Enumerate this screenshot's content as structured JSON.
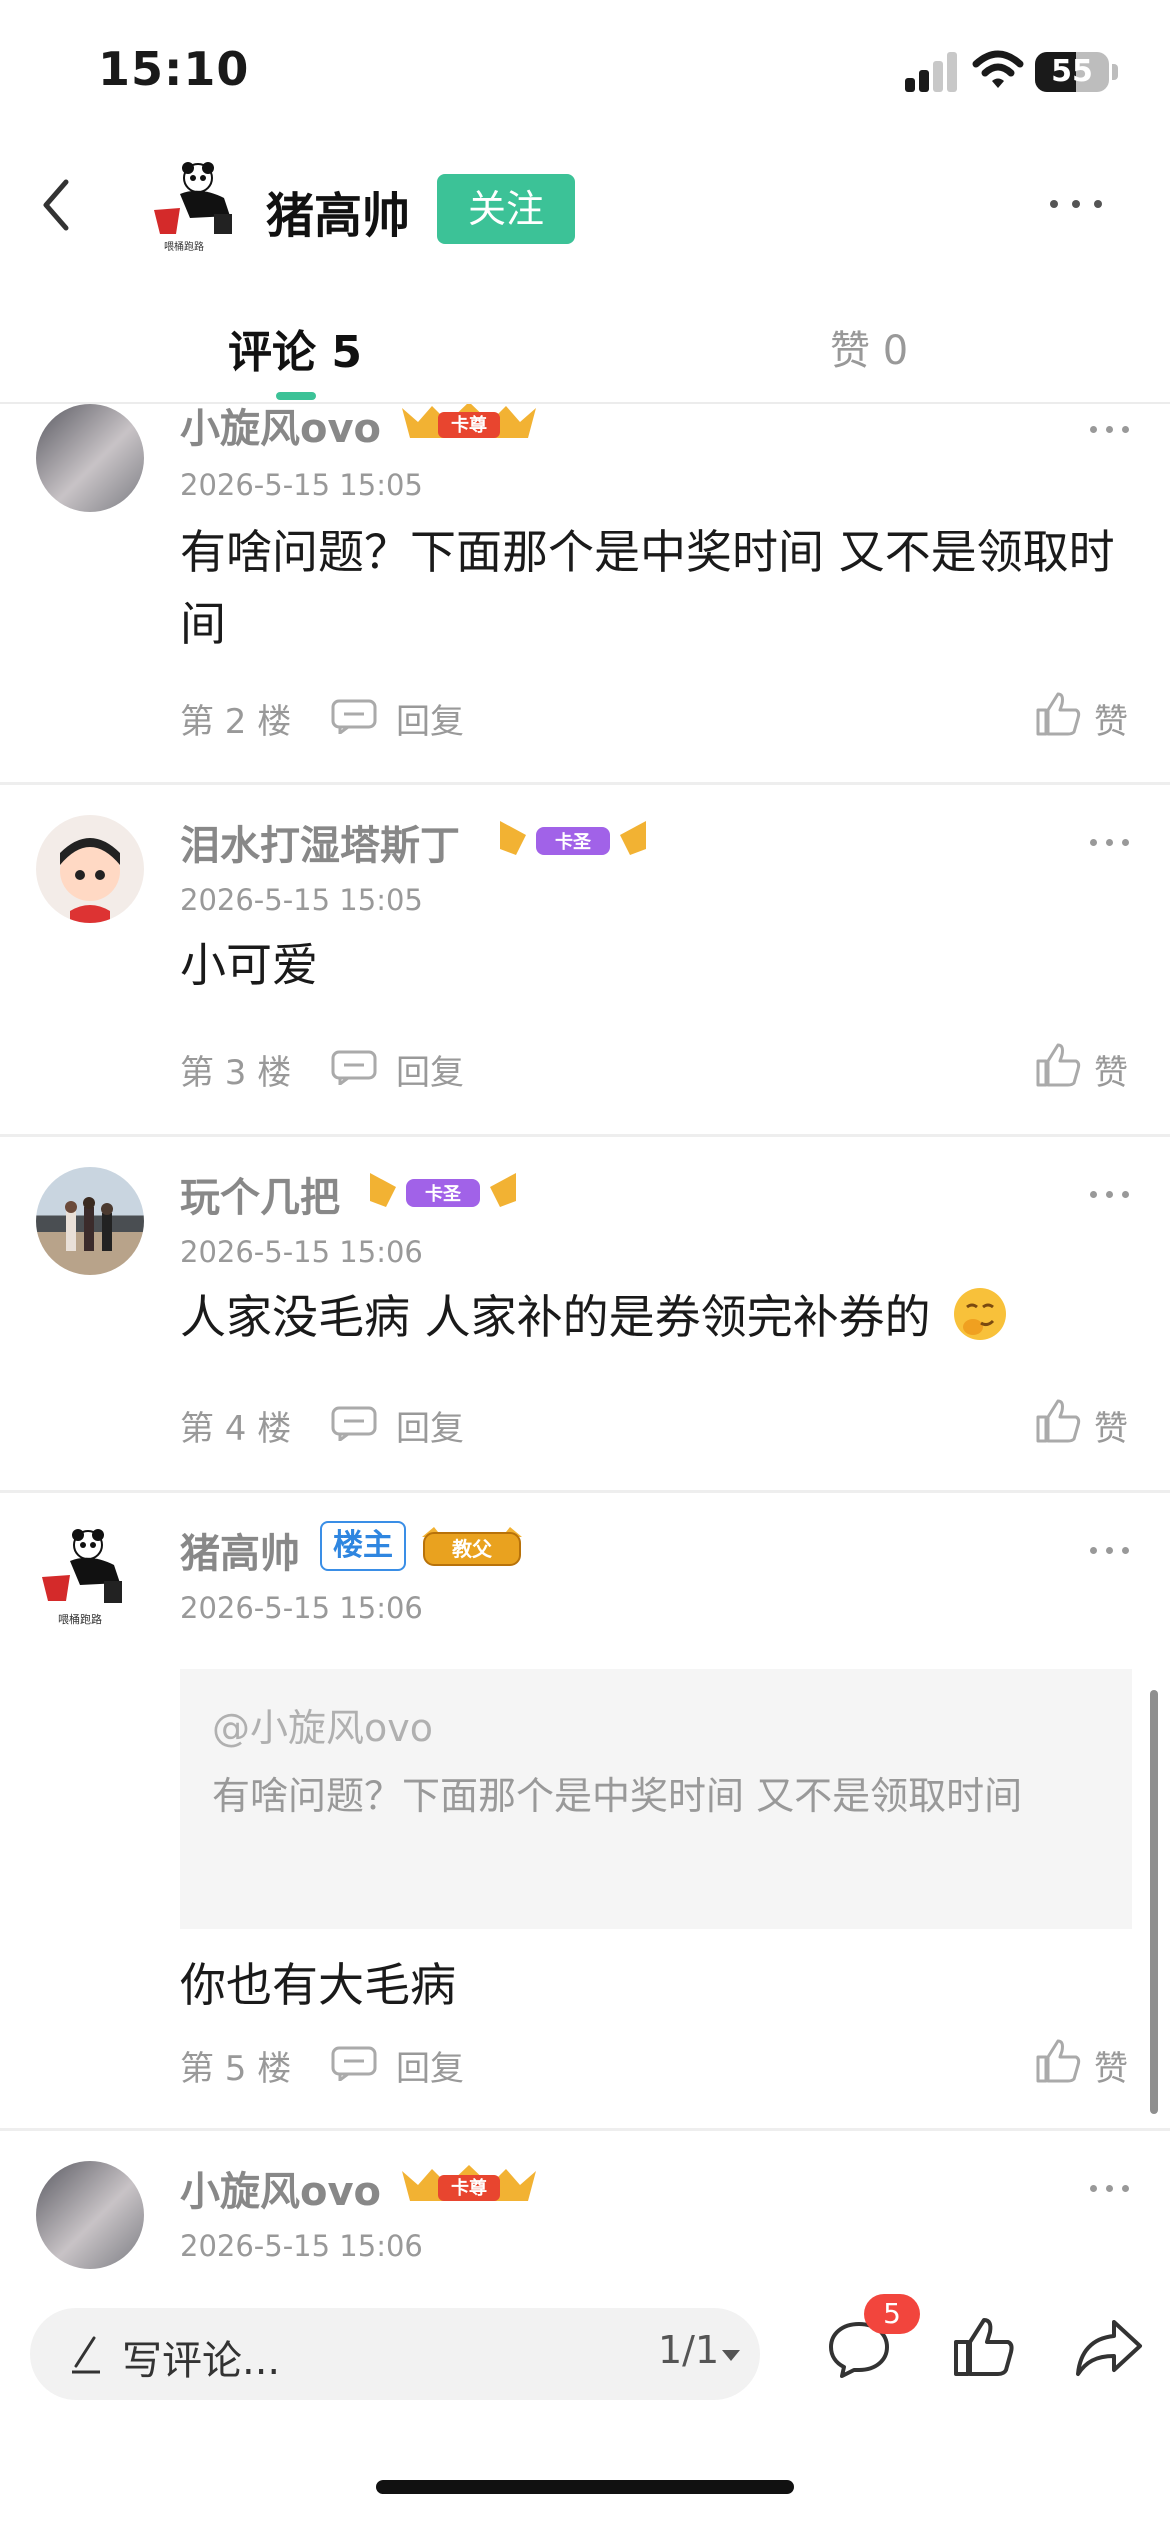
{
  "status_bar": {
    "time": "15:10",
    "battery_level": "55",
    "signal_bars": 2,
    "signal_icon": "cellular-signal-icon",
    "wifi_icon": "wifi-icon"
  },
  "nav": {
    "back_icon": "chevron-left-icon",
    "title": "猪高帅",
    "follow_label": "关注",
    "more_icon": "more-dots-icon"
  },
  "tabs": {
    "comments_label": "评论 5",
    "likes_label": "赞 0"
  },
  "comments": [
    {
      "username": "小旋风ovo",
      "badge": "卡尊",
      "time": "2026-5-15 15:05",
      "content": "有啥问题？下面那个是中奖时间 又不是领取时间",
      "floor": "第 2 楼",
      "reply_label": "回复",
      "like_label": "赞"
    },
    {
      "username": "泪水打湿塔斯丁",
      "badge": "卡圣",
      "time": "2026-5-15 15:05",
      "content": "小可爱",
      "floor": "第 3 楼",
      "reply_label": "回复",
      "like_label": "赞"
    },
    {
      "username": "玩个几把",
      "badge": "卡圣",
      "time": "2026-5-15 15:06",
      "content": "人家没毛病 人家补的是券领完补券的",
      "emoji_icon": "smirk-face-icon",
      "floor": "第 4 楼",
      "reply_label": "回复",
      "like_label": "赞"
    },
    {
      "username": "猪高帅",
      "op_tag": "楼主",
      "badge": "教父",
      "time": "2026-5-15 15:06",
      "quote_user": "@小旋风ovo",
      "quote_text": "有啥问题？下面那个是中奖时间 又不是领取时间",
      "content": "你也有大毛病",
      "floor": "第 5 楼",
      "reply_label": "回复",
      "like_label": "赞"
    },
    {
      "username": "小旋风ovo",
      "badge": "卡尊",
      "time": "2026-5-15 15:06"
    }
  ],
  "avatar_caption": "喂桶跑路",
  "bottom_bar": {
    "input_placeholder": "写评论...",
    "page_indicator": "1/1",
    "comment_count": "5",
    "comment_icon": "comment-bubble-icon",
    "like_icon": "thumbs-up-icon",
    "share_icon": "share-arrow-icon"
  },
  "colors": {
    "accent": "#3cc297",
    "badge_red": "#f2453d",
    "op_tag_blue": "#2f86e0"
  }
}
